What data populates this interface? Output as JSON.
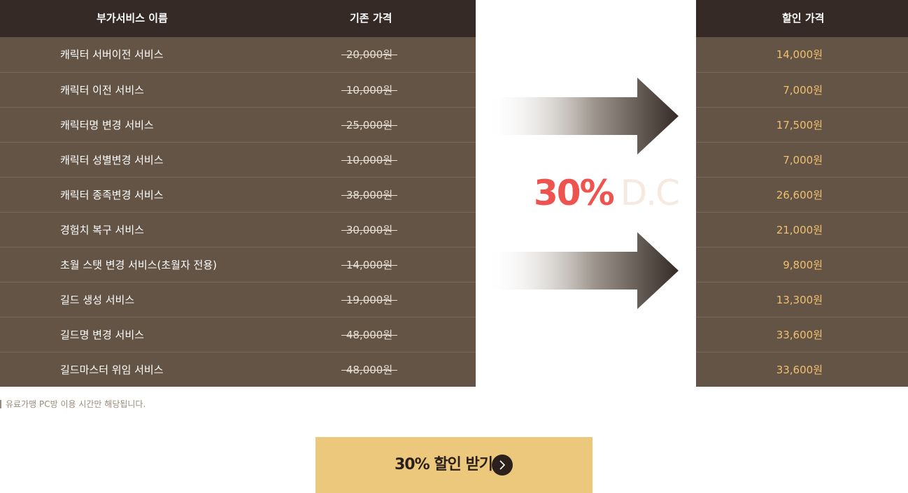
{
  "table": {
    "headers": {
      "name": "부가서비스 이름",
      "original": "기존 가격",
      "discount": "할인 가격"
    },
    "rows": [
      {
        "name": "캐릭터 서버이전 서비스",
        "original": "20,000원",
        "discount": "14,000원"
      },
      {
        "name": "캐릭터 이전 서비스",
        "original": "10,000원",
        "discount": "7,000원"
      },
      {
        "name": "캐릭터명 변경 서비스",
        "original": "25,000원",
        "discount": "17,500원"
      },
      {
        "name": "캐릭터 성별변경 서비스",
        "original": "10,000원",
        "discount": "7,000원"
      },
      {
        "name": "캐릭터 종족변경 서비스",
        "original": "38,000원",
        "discount": "26,600원"
      },
      {
        "name": "경험치 복구 서비스",
        "original": "30,000원",
        "discount": "21,000원"
      },
      {
        "name": "초월 스탯 변경 서비스(초월자 전용)",
        "original": "14,000원",
        "discount": "9,800원"
      },
      {
        "name": "길드 생성 서비스",
        "original": "19,000원",
        "discount": "13,300원"
      },
      {
        "name": "길드명 변경 서비스",
        "original": "48,000원",
        "discount": "33,600원"
      },
      {
        "name": "길드마스터 위임 서비스",
        "original": "48,000원",
        "discount": "33,600원"
      }
    ]
  },
  "promo": {
    "percent": "30%",
    "suffix": "D.C"
  },
  "note": "유료가맹 PC방 이용 시간만 해당됩니다.",
  "cta": {
    "label": "30% 할인 받기",
    "icon": "chevron-right-icon"
  },
  "colors": {
    "header_bg": "#352a25",
    "row_bg": "#645446",
    "discount_text": "#f0c070",
    "accent_red": "#ef5350",
    "cta_bg": "#ecc87c"
  }
}
